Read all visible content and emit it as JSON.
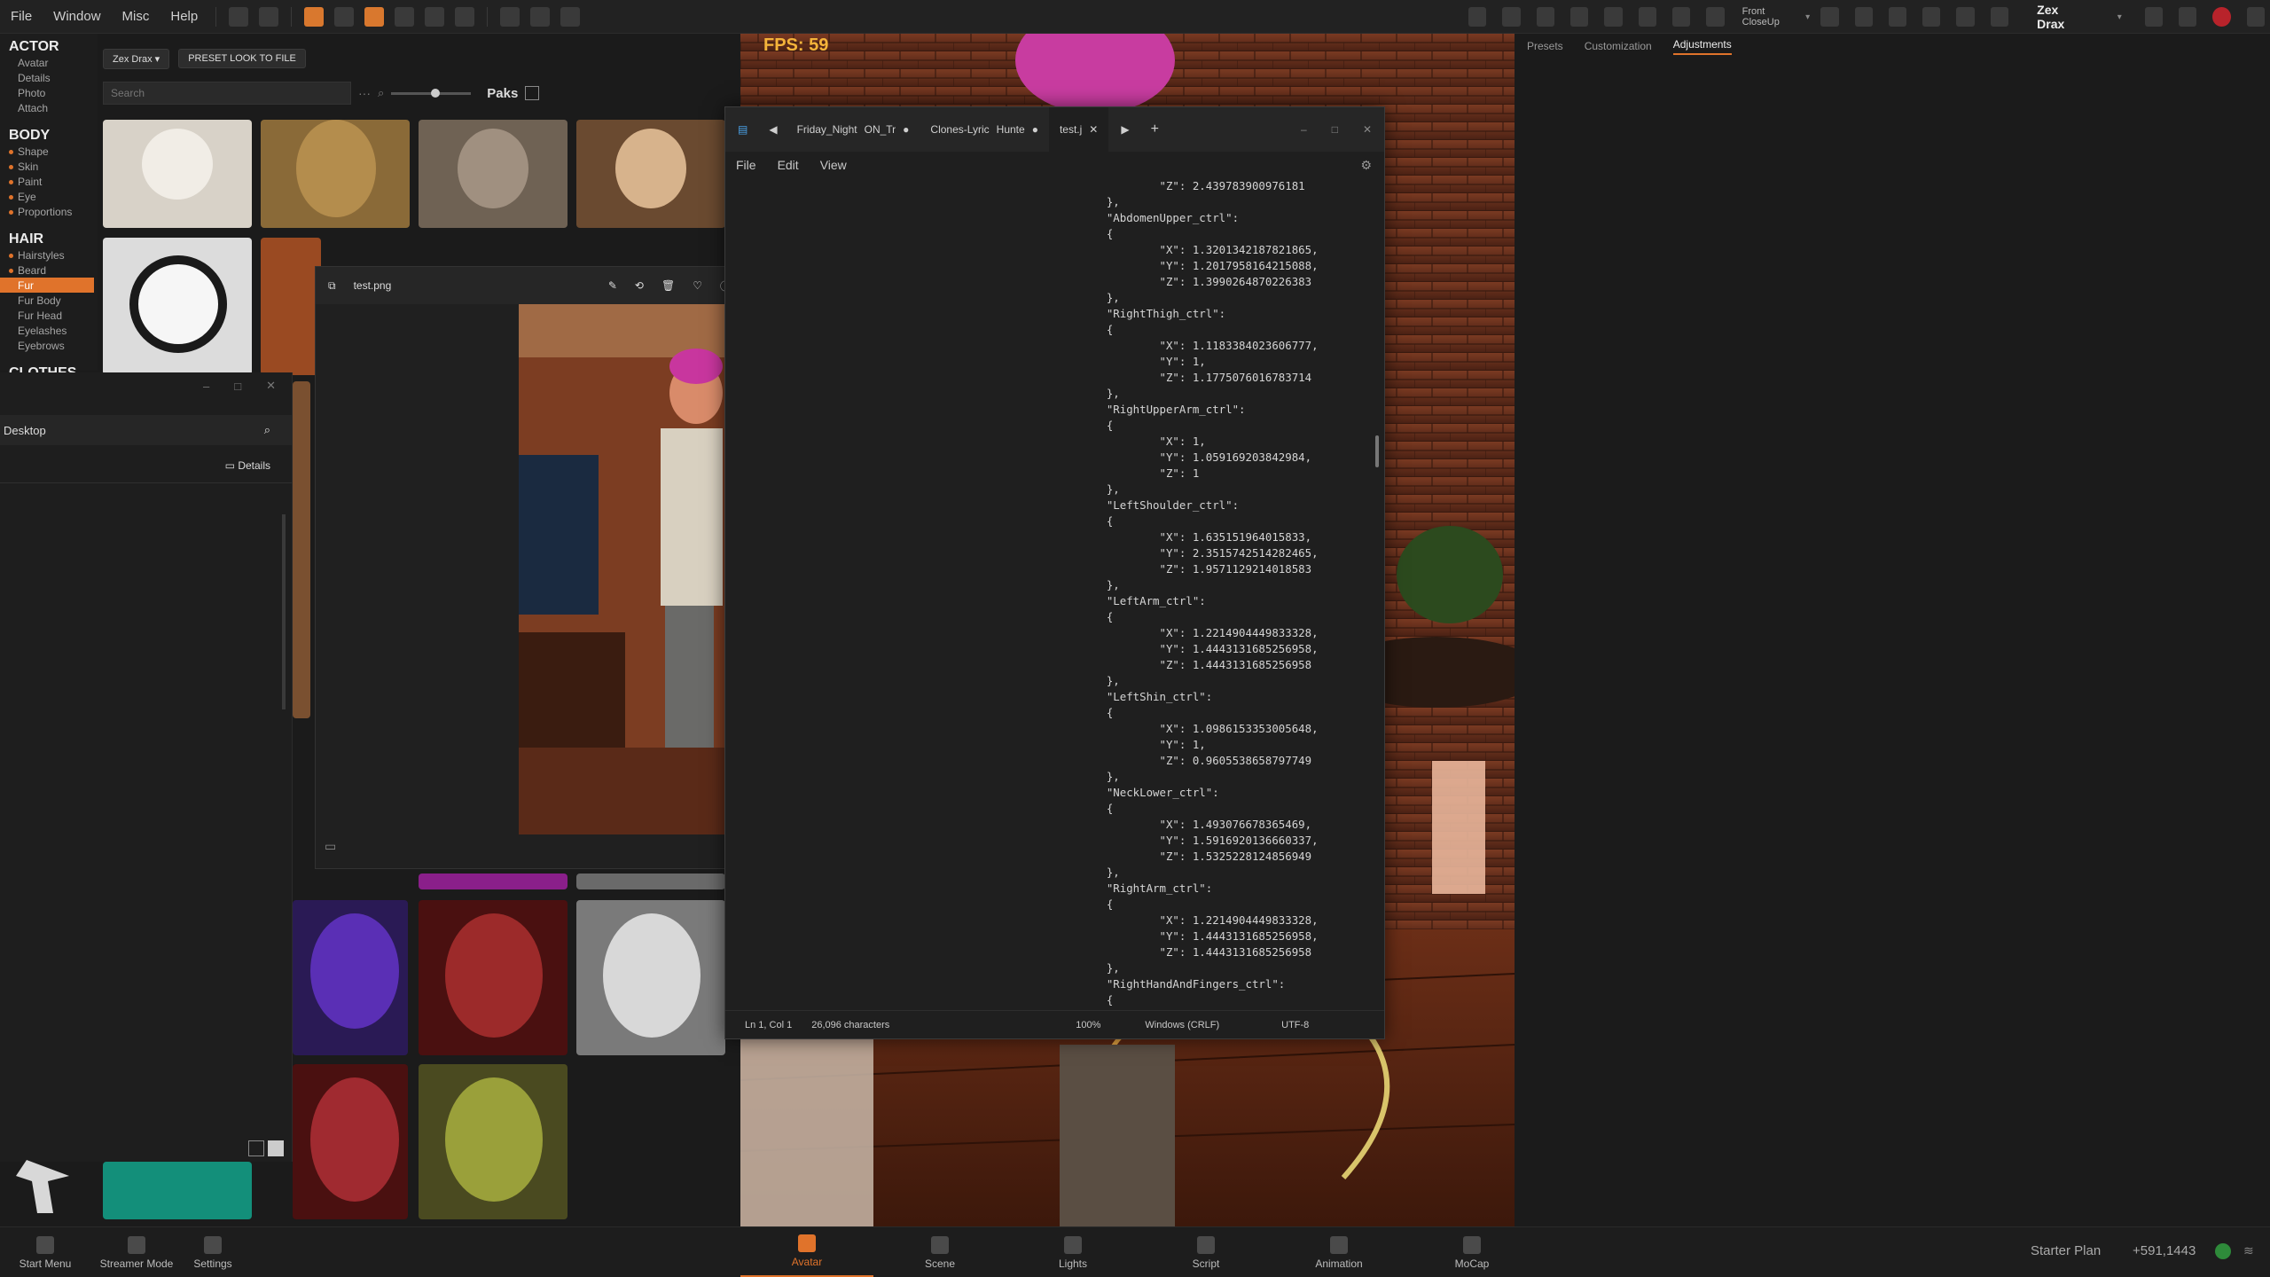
{
  "menu": {
    "file": "File",
    "window": "Window",
    "misc": "Misc",
    "help": "Help"
  },
  "topright": {
    "camera_preset": "Front CloseUp",
    "user_name": "Zex Drax"
  },
  "categories": {
    "actor": {
      "label": "ACTOR",
      "items": [
        "Avatar",
        "Details",
        "Photo",
        "Attach"
      ]
    },
    "body": {
      "label": "BODY",
      "items": [
        "Shape",
        "Skin",
        "Paint",
        "Eye",
        "Proportions"
      ]
    },
    "hair": {
      "label": "HAIR",
      "items": [
        "Hairstyles",
        "Beard",
        "Fur",
        "Fur Body",
        "Fur Head",
        "Eyelashes",
        "Eyebrows"
      ]
    },
    "clothes": {
      "label": "CLOTHES"
    }
  },
  "library": {
    "actor_chip": "Zex Drax",
    "preset_button": "PRESET LOOK TO FILE",
    "search_placeholder": "Search",
    "paks_label": "Paks"
  },
  "explorer": {
    "location": "Desktop",
    "details_label": "Details"
  },
  "viewer": {
    "filename": "test.png"
  },
  "viewport": {
    "fps": "FPS: 59"
  },
  "notepad": {
    "tabs": [
      "Friday_Night",
      "ON_Tr",
      "Clones-Lyric",
      "Hunte",
      "test.j"
    ],
    "menu": {
      "file": "File",
      "edit": "Edit",
      "view": "View"
    },
    "code_lines": [
      "            \"Z\": 2.439783900976181",
      "    },",
      "    \"AbdomenUpper_ctrl\":",
      "    {",
      "            \"X\": 1.3201342187821865,",
      "            \"Y\": 1.2017958164215088,",
      "            \"Z\": 1.3990264870226383",
      "    },",
      "    \"RightThigh_ctrl\":",
      "    {",
      "            \"X\": 1.1183384023606777,",
      "            \"Y\": 1,",
      "            \"Z\": 1.1775076016783714",
      "    },",
      "    \"RightUpperArm_ctrl\":",
      "    {",
      "            \"X\": 1,",
      "            \"Y\": 1.059169203842984,",
      "            \"Z\": 1",
      "    },",
      "    \"LeftShoulder_ctrl\":",
      "    {",
      "            \"X\": 1.635151964015833,",
      "            \"Y\": 2.3515742514282465,",
      "            \"Z\": 1.957112921401858З",
      "    },",
      "    \"LeftArm_ctrl\":",
      "    {",
      "            \"X\": 1.2214904449833328,",
      "            \"Y\": 1.4443131685256958,",
      "            \"Z\": 1.4443131685256958",
      "    },",
      "    \"LeftShin_ctrl\":",
      "    {",
      "            \"X\": 1.0986153353005648,",
      "            \"Y\": 1,",
      "            \"Z\": 0.9605538658797749",
      "    },",
      "    \"NeckLower_ctrl\":",
      "    {",
      "            \"X\": 1.493076678365469,",
      "            \"Y\": 1.5916920136660337,",
      "            \"Z\": 1.5325228124856949",
      "    },",
      "    \"RightArm_ctrl\":",
      "    {",
      "            \"X\": 1.2214904449833328,",
      "            \"Y\": 1.4443131685256958,",
      "            \"Z\": 1.4443131685256958",
      "    },",
      "    \"RightHandAndFingers_ctrl\":",
      "    {"
    ],
    "status": {
      "position": "Ln 1, Col 1",
      "chars": "26,096 characters",
      "zoom": "100%",
      "line_endings": "Windows (CRLF)",
      "encoding": "UTF-8"
    }
  },
  "right_panel": {
    "tabs": [
      "Presets",
      "Customization",
      "Adjustments"
    ],
    "active_tab": "Adjustments"
  },
  "bottom": {
    "left": [
      "Start Menu",
      "Streamer Mode",
      "Settings"
    ],
    "center": [
      "Avatar",
      "Scene",
      "Lights",
      "Script",
      "Animation",
      "MoCap"
    ],
    "active": "Avatar",
    "plan": "Starter Plan",
    "coins": "+591,1443"
  },
  "colors": {
    "accent": "#e0732b",
    "fps": "#f5b43a",
    "panel": "#1b1b1b"
  }
}
